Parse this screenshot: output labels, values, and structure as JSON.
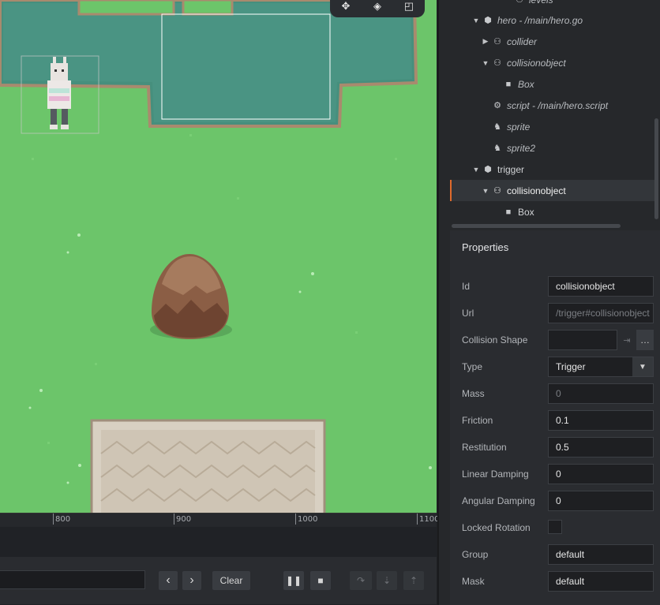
{
  "scene": {
    "ruler_ticks": [
      "800",
      "900",
      "1000",
      "1100"
    ],
    "colors": {
      "grass": "#6cc56a",
      "water": "#468f7d",
      "rock": "#8b5e45",
      "paving": "#d8d0c2"
    }
  },
  "scene_toolbar": {
    "icons": [
      "move-icon",
      "rotate-icon",
      "scale-icon"
    ]
  },
  "console": {
    "filter_value": "",
    "prev_label": "‹",
    "next_label": "›",
    "clear_label": "Clear"
  },
  "outline": {
    "partial_top": "levels",
    "items": [
      {
        "label": "hero - /main/hero.go",
        "arrow": "▼",
        "icon": "gameobject-icon"
      },
      {
        "label": "collider",
        "arrow": "▶",
        "icon": "collision-icon"
      },
      {
        "label": "collisionobject",
        "arrow": "▼",
        "icon": "collision-icon"
      },
      {
        "label": "Box",
        "arrow": "",
        "icon": "box-icon"
      },
      {
        "label": "script - /main/hero.script",
        "arrow": "",
        "icon": "gear-icon"
      },
      {
        "label": "sprite",
        "arrow": "",
        "icon": "sprite-icon"
      },
      {
        "label": "sprite2",
        "arrow": "",
        "icon": "sprite-icon"
      },
      {
        "label": "trigger",
        "arrow": "▼",
        "icon": "gameobject-icon"
      },
      {
        "label": "collisionobject",
        "arrow": "▼",
        "icon": "collision-icon"
      },
      {
        "label": "Box",
        "arrow": "",
        "icon": "box-icon"
      }
    ],
    "accent_color": "#e06a2c"
  },
  "properties": {
    "title": "Properties",
    "fields": {
      "id": {
        "label": "Id",
        "value": "collisionobject"
      },
      "url": {
        "label": "Url",
        "value": "/trigger#collisionobject"
      },
      "collision_shape": {
        "label": "Collision Shape",
        "value": "",
        "browse": "…",
        "goto": "⇥"
      },
      "type": {
        "label": "Type",
        "value": "Trigger"
      },
      "mass": {
        "label": "Mass",
        "value": "0"
      },
      "friction": {
        "label": "Friction",
        "value": "0.1"
      },
      "restitution": {
        "label": "Restitution",
        "value": "0.5"
      },
      "linear_damping": {
        "label": "Linear Damping",
        "value": "0"
      },
      "angular_damping": {
        "label": "Angular Damping",
        "value": "0"
      },
      "locked_rotation": {
        "label": "Locked Rotation",
        "checked": false
      },
      "group": {
        "label": "Group",
        "value": "default"
      },
      "mask": {
        "label": "Mask",
        "value": "default"
      }
    }
  }
}
